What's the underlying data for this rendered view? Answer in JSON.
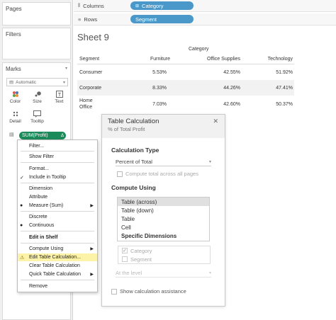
{
  "left_panel": {
    "pages_label": "Pages",
    "filters_label": "Filters",
    "marks_label": "Marks",
    "marks_type": "Automatic",
    "mark_buttons": [
      {
        "label": "Color",
        "icon": "color-icon"
      },
      {
        "label": "Size",
        "icon": "size-icon"
      },
      {
        "label": "Text",
        "icon": "text-icon"
      },
      {
        "label": "Detail",
        "icon": "detail-icon"
      },
      {
        "label": "Tooltip",
        "icon": "tooltip-icon"
      }
    ],
    "profit_pill": "SUM(Profit)"
  },
  "shelves": {
    "columns_label": "Columns",
    "columns_pill": "Category",
    "rows_label": "Rows",
    "rows_pill": "Segment"
  },
  "sheet": {
    "title": "Sheet 9",
    "column_group": "Category",
    "headers": [
      "Segment",
      "Furniture",
      "Office Supplies",
      "Technology"
    ],
    "rows": [
      {
        "segment": [
          "Consumer"
        ],
        "values": [
          "5.53%",
          "42.55%",
          "51.92%"
        ]
      },
      {
        "segment": [
          "Corporate"
        ],
        "values": [
          "8.33%",
          "44.26%",
          "47.41%"
        ]
      },
      {
        "segment": [
          "Home",
          "Office"
        ],
        "values": [
          "7.03%",
          "42.60%",
          "50.37%"
        ]
      }
    ]
  },
  "context_menu": {
    "items": [
      "Filter...",
      "Show Filter",
      "Format...",
      "Include in Tooltip",
      "Dimension",
      "Attribute",
      "Measure (Sum)",
      "Discrete",
      "Continuous",
      "Edit in Shelf",
      "Compute Using",
      "Edit Table Calculation...",
      "Clear Table Calculation",
      "Quick Table Calculation",
      "Remove"
    ]
  },
  "dialog": {
    "title": "Table Calculation",
    "subtitle": "% of Total Profit",
    "calc_type_label": "Calculation Type",
    "calc_type_value": "Percent of Total",
    "compute_total_label": "Compute total across all pages",
    "compute_using_label": "Compute Using",
    "compute_options": [
      "Table (across)",
      "Table (down)",
      "Table",
      "Cell",
      "Specific Dimensions"
    ],
    "dimensions": [
      "Category",
      "Segment"
    ],
    "at_level_label": "At the level",
    "assist_label": "Show calculation assistance"
  },
  "colors": {
    "blue_pill": "#4a98c9",
    "green_pill": "#1b8a5a",
    "highlight": "#fdf3a8"
  }
}
